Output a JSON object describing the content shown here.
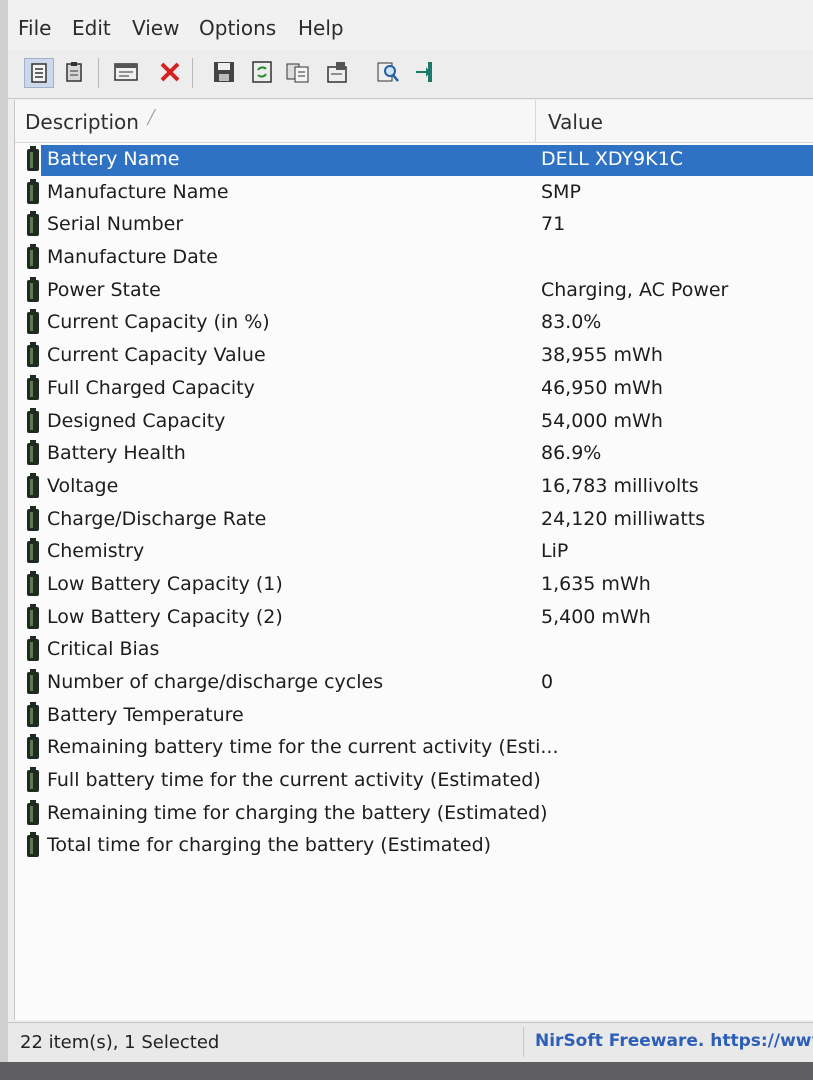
{
  "menu": [
    "File",
    "Edit",
    "View",
    "Options",
    "Help"
  ],
  "toolbar_icons": [
    "html-report-all-icon",
    "html-report-selected-icon",
    "properties-icon",
    "delete-icon",
    "save-icon",
    "refresh-icon",
    "copy-icon",
    "advanced-options-icon",
    "find-icon",
    "exit-icon"
  ],
  "columns": {
    "description": "Description",
    "value": "Value"
  },
  "rows": [
    {
      "desc": "Battery Name",
      "value": "DELL XDY9K1C",
      "selected": true
    },
    {
      "desc": "Manufacture Name",
      "value": "SMP"
    },
    {
      "desc": "Serial Number",
      "value": "71"
    },
    {
      "desc": "Manufacture Date",
      "value": ""
    },
    {
      "desc": "Power State",
      "value": "Charging, AC Power"
    },
    {
      "desc": "Current Capacity (in %)",
      "value": "83.0%"
    },
    {
      "desc": "Current Capacity Value",
      "value": "38,955 mWh"
    },
    {
      "desc": "Full Charged Capacity",
      "value": "46,950 mWh"
    },
    {
      "desc": "Designed Capacity",
      "value": "54,000 mWh"
    },
    {
      "desc": "Battery Health",
      "value": "86.9%"
    },
    {
      "desc": "Voltage",
      "value": "16,783 millivolts"
    },
    {
      "desc": "Charge/Discharge Rate",
      "value": "24,120 milliwatts"
    },
    {
      "desc": "Chemistry",
      "value": "LiP"
    },
    {
      "desc": "Low Battery Capacity (1)",
      "value": "1,635 mWh"
    },
    {
      "desc": "Low Battery Capacity (2)",
      "value": "5,400 mWh"
    },
    {
      "desc": "Critical Bias",
      "value": ""
    },
    {
      "desc": "Number of charge/discharge cycles",
      "value": "0"
    },
    {
      "desc": "Battery Temperature",
      "value": ""
    },
    {
      "desc": "Remaining battery time for the current activity (Esti...",
      "value": ""
    },
    {
      "desc": "Full battery time for the current activity (Estimated)",
      "value": ""
    },
    {
      "desc": "Remaining time for charging the battery (Estimated)",
      "value": ""
    },
    {
      "desc": "Total  time for charging the battery (Estimated)",
      "value": ""
    }
  ],
  "status": {
    "items": "22 item(s), 1 Selected",
    "credit": "NirSoft Freeware. https://www"
  },
  "colors": {
    "selection": "#2f72c3",
    "credit_link": "#2e5fb8"
  }
}
